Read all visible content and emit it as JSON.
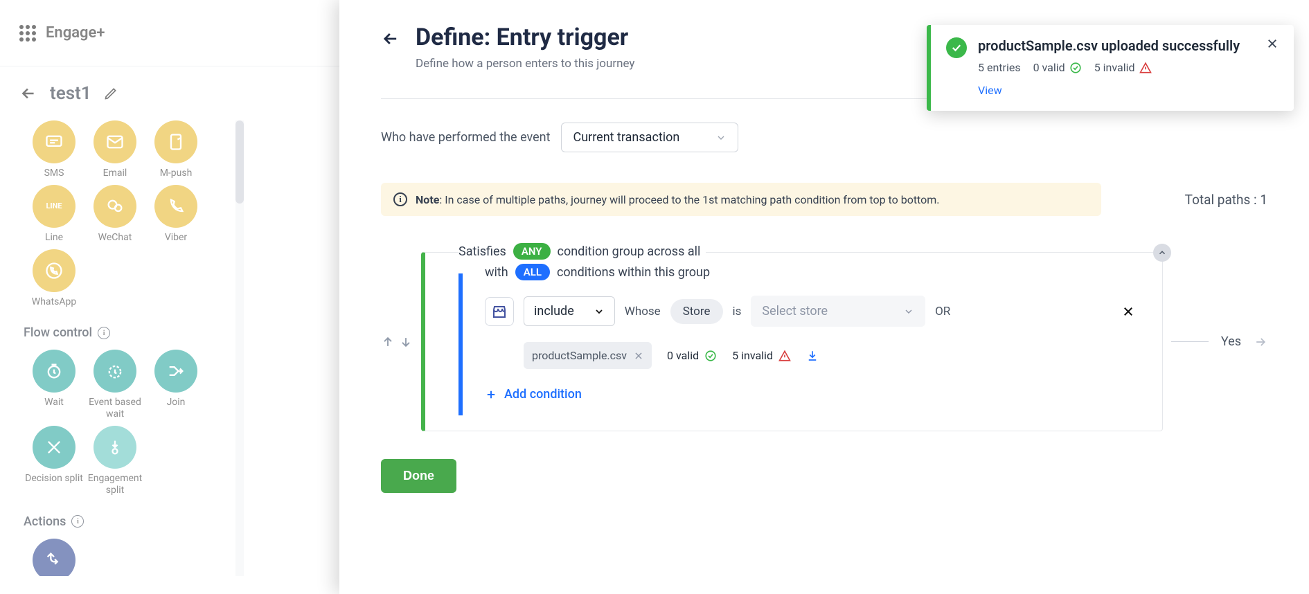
{
  "header": {
    "brand": "Engage+",
    "journey_name": "test1"
  },
  "tools": {
    "channels": [
      {
        "label": "SMS"
      },
      {
        "label": "Email"
      },
      {
        "label": "M-push"
      },
      {
        "label": "Line"
      },
      {
        "label": "WeChat"
      },
      {
        "label": "Viber"
      },
      {
        "label": "WhatsApp"
      }
    ],
    "flow_section": "Flow control",
    "flow": [
      {
        "label": "Wait"
      },
      {
        "label": "Event based wait"
      },
      {
        "label": "Join"
      },
      {
        "label": "Decision split"
      },
      {
        "label": "Engagement split"
      }
    ],
    "actions_section": "Actions"
  },
  "panel": {
    "title": "Define: Entry trigger",
    "subtitle": "Define how a person enters to this journey",
    "event_label": "Who have performed the event",
    "event_selected": "Current transaction",
    "note_prefix": "Note",
    "note_body": ": In case of multiple paths, journey will proceed to the 1st matching path condition from top to bottom.",
    "total_paths": "Total paths : 1",
    "satisfies_text_a": "Satisfies",
    "satisfies_pill": "ANY",
    "satisfies_text_b": "condition group across all",
    "with_text_a": "with",
    "with_pill": "ALL",
    "with_text_b": "conditions within this group",
    "include_selected": "include",
    "whose": "Whose",
    "store_tag": "Store",
    "is_text": "is",
    "select_store_placeholder": "Select store",
    "or_text": "OR",
    "file_name": "productSample.csv",
    "valid_text": "0 valid",
    "invalid_text": "5 invalid",
    "add_condition": "Add condition",
    "yes_label": "Yes",
    "done": "Done"
  },
  "toast": {
    "title": "productSample.csv uploaded successfully",
    "entries": "5 entries",
    "valid": "0 valid",
    "invalid": "5 invalid",
    "view": "View"
  }
}
